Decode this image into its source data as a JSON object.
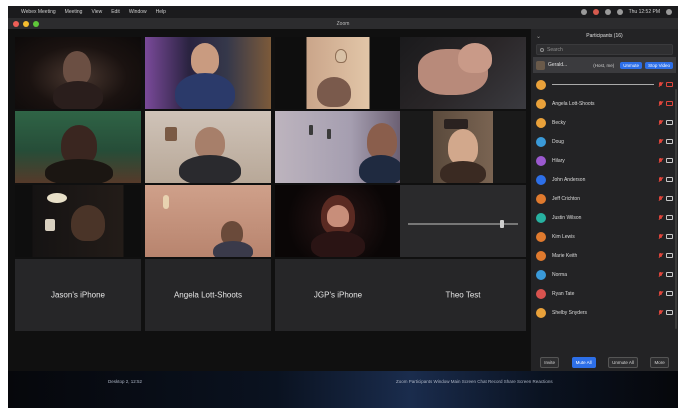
{
  "menubar": {
    "app_menus": [
      "Webex Meeting",
      "Meeting",
      "View",
      "Edit",
      "Window",
      "Help"
    ],
    "status_text": "Thu 12:52 PM"
  },
  "window": {
    "title": "Zoom"
  },
  "tiles": [
    {
      "id": "t1",
      "name": "",
      "kind": "video",
      "active": false
    },
    {
      "id": "t2",
      "name": "",
      "kind": "video",
      "active": false
    },
    {
      "id": "t3",
      "name": "",
      "kind": "video",
      "active": false
    },
    {
      "id": "t4",
      "name": "",
      "kind": "video",
      "active": true
    },
    {
      "id": "t5",
      "name": "",
      "kind": "video",
      "active": false
    },
    {
      "id": "t6",
      "name": "",
      "kind": "video",
      "active": false
    },
    {
      "id": "t7",
      "name": "",
      "kind": "video",
      "active": false
    },
    {
      "id": "t8",
      "name": "",
      "kind": "video",
      "active": false
    },
    {
      "id": "t9",
      "name": "",
      "kind": "video",
      "active": false
    },
    {
      "id": "t10",
      "name": "",
      "kind": "video",
      "active": false
    },
    {
      "id": "t11",
      "name": "",
      "kind": "video",
      "active": false
    },
    {
      "id": "t12",
      "name": "",
      "kind": "slider",
      "active": false
    },
    {
      "id": "t13",
      "name": "Jason's iPhone",
      "kind": "name",
      "active": false
    },
    {
      "id": "t14",
      "name": "Angela Lott-Shoots",
      "kind": "name",
      "active": false
    },
    {
      "id": "t15",
      "name": "JGP's iPhone",
      "kind": "name",
      "active": false
    },
    {
      "id": "t16",
      "name": "Theo Test",
      "kind": "name",
      "active": false
    }
  ],
  "panel": {
    "title": "Participants (16)",
    "search_placeholder": "Search",
    "self": {
      "name": "Gerald...",
      "me_label": "(Host, me)",
      "unmute_label": "Unmute",
      "stop_video_label": "Stop Video"
    },
    "participants": [
      {
        "name": "",
        "color": "#e9a13a",
        "kind": "level"
      },
      {
        "name": "Angela Lott-Shoots",
        "color": "#e9a13a",
        "kind": "name"
      },
      {
        "name": "Becky",
        "color": "#e9a13a",
        "kind": "name"
      },
      {
        "name": "Doug",
        "color": "#3a9ad9",
        "kind": "name"
      },
      {
        "name": "Hilary",
        "color": "#9b59d0",
        "kind": "name"
      },
      {
        "name": "John Anderson",
        "color": "#2d6fe8",
        "kind": "name"
      },
      {
        "name": "Jeff Crichton",
        "color": "#e07a2e",
        "kind": "name"
      },
      {
        "name": "Justin Wilson",
        "color": "#27b1a0",
        "kind": "name"
      },
      {
        "name": "Kim Lewis",
        "color": "#e07a2e",
        "kind": "name"
      },
      {
        "name": "Marie Keith",
        "color": "#e07a2e",
        "kind": "name"
      },
      {
        "name": "Norma",
        "color": "#3a9ad9",
        "kind": "name"
      },
      {
        "name": "Ryan Tate",
        "color": "#d9534f",
        "kind": "name"
      },
      {
        "name": "Shelby Snyders",
        "color": "#e9a13a",
        "kind": "name"
      }
    ],
    "footer": {
      "invite_label": "Invite",
      "mute_all_label": "Mute All",
      "unmute_all_label": "Unmute All",
      "more_label": "More"
    }
  },
  "dock": {
    "left_text": "Desktop 2, 12:52",
    "right_text": "Zoom Participants Window Main Screen Chat Record Share Screen Reactions"
  },
  "colors": {
    "accent_blue": "#2d6fe8",
    "active_speaker": "#c9d35a",
    "muted_red": "#e0463c"
  }
}
